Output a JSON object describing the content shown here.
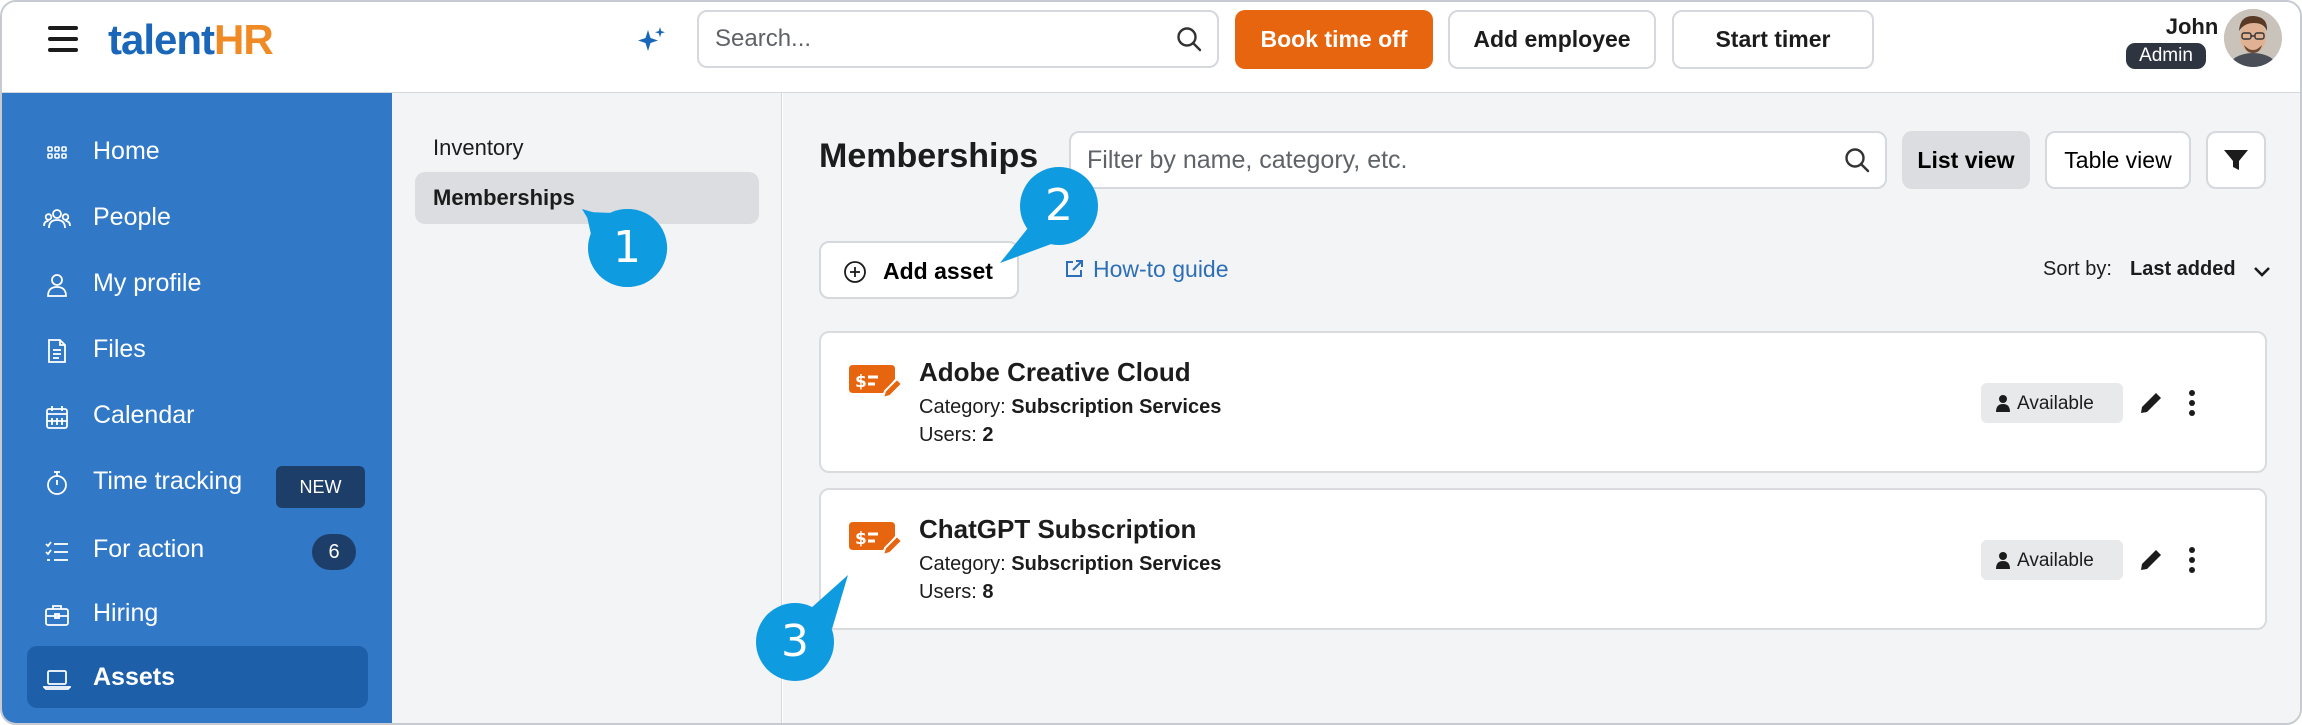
{
  "topbar": {
    "logo_part1": "talent",
    "logo_part2": "HR",
    "search_placeholder": "Search...",
    "book_time_off": "Book time off",
    "add_employee": "Add employee",
    "start_timer": "Start timer",
    "user_name": "John",
    "user_role": "Admin"
  },
  "sidebar": {
    "items": [
      {
        "label": "Home",
        "icon": "grid-icon"
      },
      {
        "label": "People",
        "icon": "people-icon"
      },
      {
        "label": "My profile",
        "icon": "user-icon"
      },
      {
        "label": "Files",
        "icon": "file-icon"
      },
      {
        "label": "Calendar",
        "icon": "calendar-icon"
      },
      {
        "label": "Time tracking",
        "icon": "stopwatch-icon",
        "badge": "NEW"
      },
      {
        "label": "For action",
        "icon": "checklist-icon",
        "count": "6"
      },
      {
        "label": "Hiring",
        "icon": "briefcase-icon"
      },
      {
        "label": "Assets",
        "icon": "laptop-icon",
        "active": true
      }
    ]
  },
  "subnav": {
    "items": [
      {
        "label": "Inventory"
      },
      {
        "label": "Memberships",
        "active": true
      }
    ]
  },
  "main": {
    "title": "Memberships",
    "filter_placeholder": "Filter by name, category, etc.",
    "list_view": "List view",
    "table_view": "Table view",
    "add_asset": "Add asset",
    "howto": "How-to guide",
    "sort_label": "Sort by:",
    "sort_value": "Last added",
    "cards": [
      {
        "title": "Adobe Creative Cloud",
        "category_label": "Category:",
        "category": "Subscription Services",
        "users_label": "Users:",
        "users": "2",
        "status": "Available"
      },
      {
        "title": "ChatGPT Subscription",
        "category_label": "Category:",
        "category": "Subscription Services",
        "users_label": "Users:",
        "users": "8",
        "status": "Available"
      }
    ]
  },
  "callouts": [
    "1",
    "2",
    "3"
  ],
  "colors": {
    "accent_orange": "#e8650f",
    "sidebar_blue": "#3178c6",
    "callout_blue": "#0f9be0",
    "link_blue": "#2d6fb6"
  }
}
